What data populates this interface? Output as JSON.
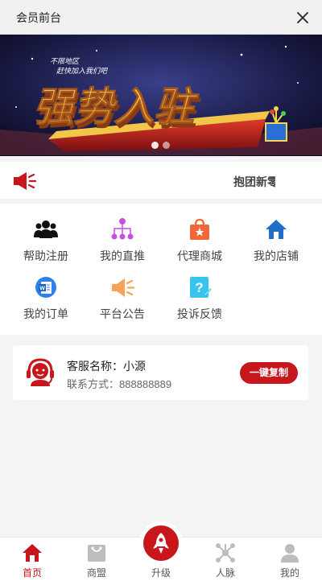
{
  "header": {
    "title": "会员前台"
  },
  "banner": {
    "small_line1": "不限地区",
    "small_line2": "赶快加入我们吧",
    "headline": "强势入驻",
    "slide_count": 2,
    "active_slide": 1
  },
  "notice": {
    "text": "抱团新零售"
  },
  "menu": [
    {
      "label": "帮助注册",
      "icon": "people-group-icon",
      "color": "#111111"
    },
    {
      "label": "我的直推",
      "icon": "hierarchy-icon",
      "color": "#c94fe0"
    },
    {
      "label": "代理商城",
      "icon": "shopping-bag-icon",
      "color": "#f2673a"
    },
    {
      "label": "我的店铺",
      "icon": "home-icon",
      "color": "#1f6fc7"
    },
    {
      "label": "我的订单",
      "icon": "word-document-icon",
      "color": "#2f80ed"
    },
    {
      "label": "平台公告",
      "icon": "megaphone-icon",
      "color": "#f5a35a"
    },
    {
      "label": "投诉反馈",
      "icon": "question-note-icon",
      "color": "#39c4ee"
    }
  ],
  "service": {
    "name_label": "客服名称：小源",
    "contact_label": "联系方式：888888889",
    "copy_button": "一键复制"
  },
  "tabbar": [
    {
      "label": "首页",
      "icon": "home-icon",
      "active": true
    },
    {
      "label": "商盟",
      "icon": "shopping-bag-icon",
      "active": false
    },
    {
      "label": "升级",
      "icon": "rocket-icon",
      "active": false
    },
    {
      "label": "人脉",
      "icon": "network-icon",
      "active": false
    },
    {
      "label": "我的",
      "icon": "user-icon",
      "active": false
    }
  ],
  "colors": {
    "brand_red": "#c8161d",
    "page_bg": "#f4f4f4"
  }
}
